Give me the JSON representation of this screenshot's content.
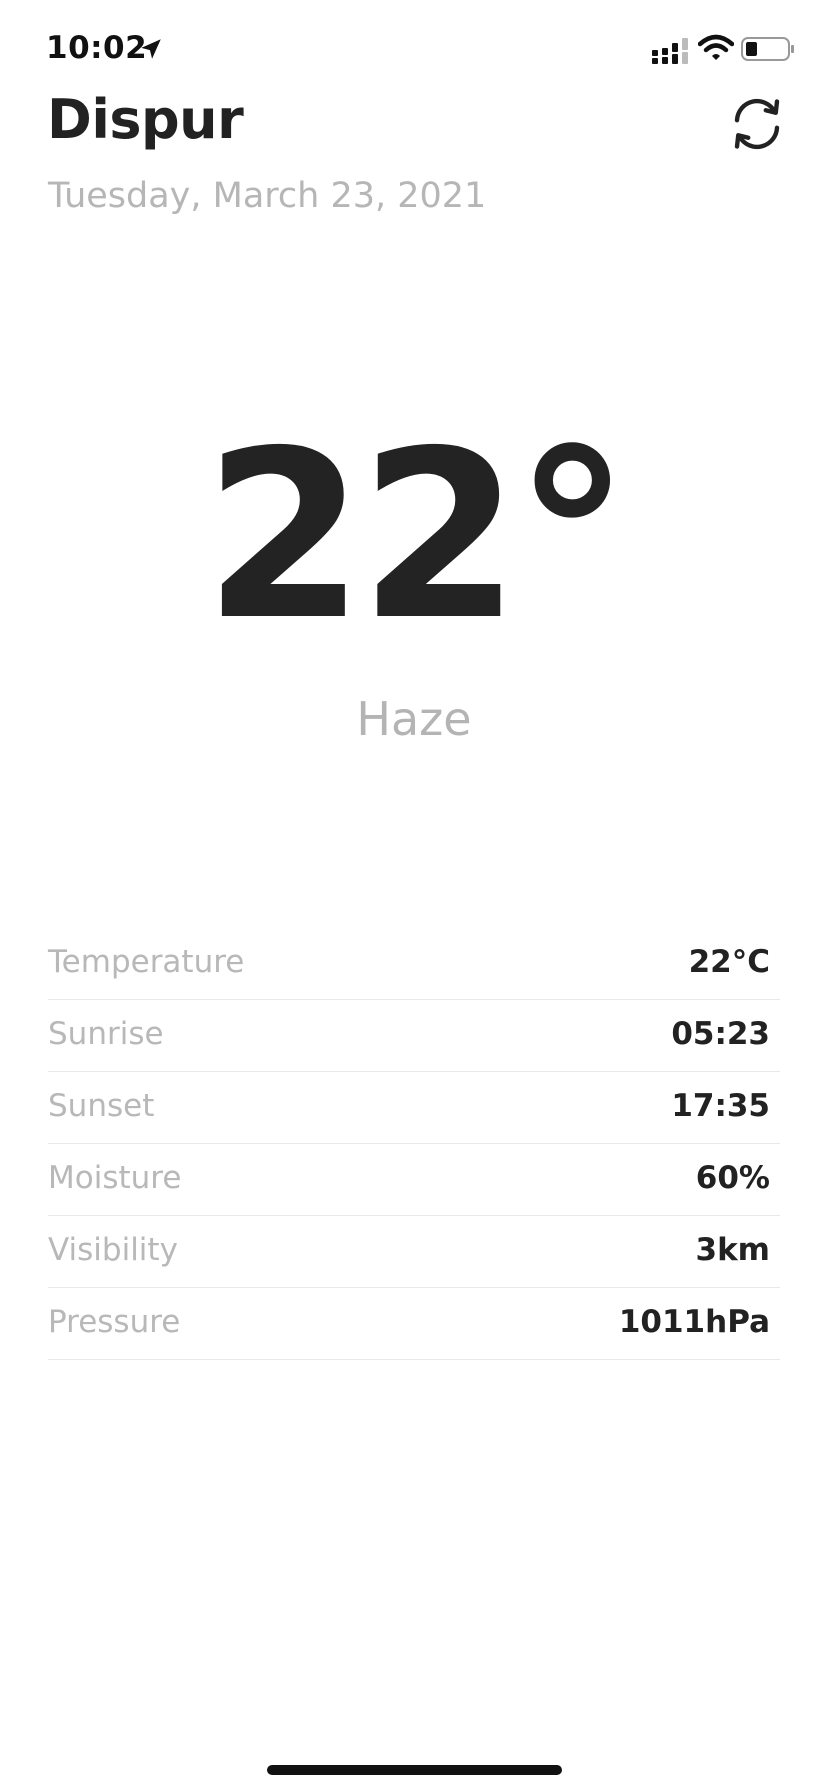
{
  "status_bar": {
    "time": "10:02",
    "icons": [
      "location-arrow-icon",
      "signal-icon",
      "wifi-icon",
      "battery-icon"
    ]
  },
  "header": {
    "city": "Dispur",
    "date": "Tuesday, March 23, 2021",
    "refresh_icon": "refresh-icon"
  },
  "current": {
    "temperature": "22°",
    "condition": "Haze"
  },
  "details": [
    {
      "label": "Temperature",
      "value": "22°C"
    },
    {
      "label": "Sunrise",
      "value": "05:23"
    },
    {
      "label": "Sunset",
      "value": "17:35"
    },
    {
      "label": "Moisture",
      "value": "60%"
    },
    {
      "label": "Visibility",
      "value": "3km"
    },
    {
      "label": "Pressure",
      "value": "1011hPa"
    }
  ],
  "colors": {
    "primary_text": "#222222",
    "secondary_text": "#b6b6b6",
    "divider": "#e8e8e8",
    "background": "#ffffff"
  }
}
